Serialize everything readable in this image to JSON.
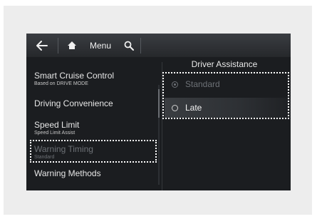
{
  "toolbar": {
    "menu_label": "Menu"
  },
  "header": {
    "title": "Driver Assistance"
  },
  "sidebar": {
    "items": [
      {
        "label": "Smart Cruise Control",
        "sublabel": "Based on DRIVE MODE"
      },
      {
        "label": "Driving Convenience"
      },
      {
        "label": "Speed Limit",
        "sublabel": "Speed Limit Assist"
      },
      {
        "label": "Warning Timing",
        "sublabel": "Standard"
      },
      {
        "label": "Warning Methods"
      }
    ]
  },
  "options": [
    {
      "label": "Standard",
      "state": "disabled"
    },
    {
      "label": "Late",
      "state": "highlighted"
    }
  ]
}
